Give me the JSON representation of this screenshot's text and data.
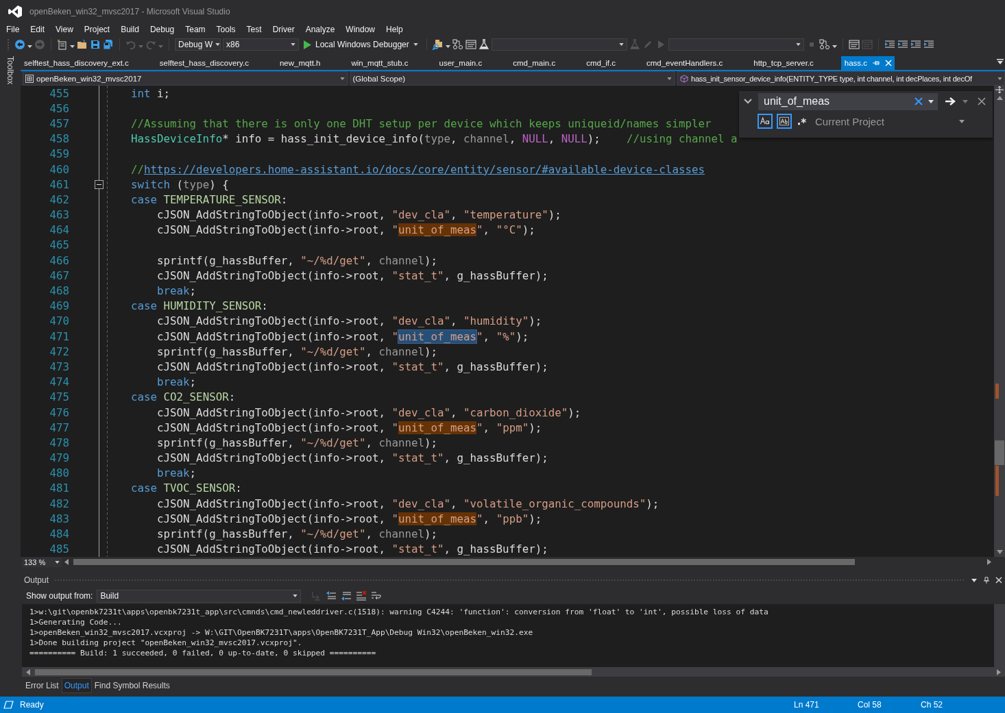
{
  "window": {
    "title": "openBeken_win32_mvsc2017 - Microsoft Visual Studio"
  },
  "menu": [
    "File",
    "Edit",
    "View",
    "Project",
    "Build",
    "Debug",
    "Team",
    "Tools",
    "Test",
    "Driver",
    "Analyze",
    "Window",
    "Help"
  ],
  "toolbar": [
    {
      "kind": "back",
      "disabled": false
    },
    {
      "kind": "caret",
      "disabled": false
    },
    {
      "kind": "forward",
      "disabled": true
    },
    {
      "kind": "sep"
    },
    {
      "kind": "new",
      "disabled": false
    },
    {
      "kind": "caret",
      "disabled": false
    },
    {
      "kind": "open",
      "disabled": false
    },
    {
      "kind": "save",
      "disabled": false
    },
    {
      "kind": "saveall",
      "disabled": false
    },
    {
      "kind": "sep"
    },
    {
      "kind": "undo",
      "disabled": true
    },
    {
      "kind": "caret",
      "disabled": true
    },
    {
      "kind": "redo",
      "disabled": true
    },
    {
      "kind": "caret",
      "disabled": true
    },
    {
      "kind": "sep"
    },
    {
      "kind": "combo",
      "value": "Debug W"
    },
    {
      "kind": "combo",
      "value": "x86"
    },
    {
      "kind": "run",
      "label": "Local Windows Debugger"
    },
    {
      "kind": "sep"
    },
    {
      "kind": "find",
      "disabled": false
    },
    {
      "kind": "caret",
      "disabled": false
    },
    {
      "kind": "branch",
      "disabled": false
    },
    {
      "kind": "window",
      "disabled": false
    },
    {
      "kind": "flask",
      "disabled": false
    },
    {
      "kind": "combo"
    },
    {
      "kind": "flask",
      "disabled": true
    },
    {
      "kind": "pencil",
      "disabled": true
    },
    {
      "kind": "play",
      "disabled": true
    },
    {
      "kind": "combo"
    },
    {
      "kind": "stop",
      "disabled": true
    },
    {
      "kind": "branch",
      "disabled": false
    },
    {
      "kind": "caret",
      "disabled": false
    },
    {
      "kind": "sep"
    },
    {
      "kind": "window",
      "disabled": false
    },
    {
      "kind": "window",
      "disabled": true
    },
    {
      "kind": "sep"
    },
    {
      "kind": "indent",
      "disabled": false
    },
    {
      "kind": "indent",
      "disabled": false
    },
    {
      "kind": "indent",
      "disabled": false
    },
    {
      "kind": "indent",
      "disabled": false
    }
  ],
  "toolbox": {
    "label": "Toolbox"
  },
  "tabs": [
    {
      "label": "selftest_hass_discovery_ext.c",
      "selected": false
    },
    {
      "label": "selftest_hass_discovery.c",
      "selected": false
    },
    {
      "label": "new_mqtt.h",
      "selected": false
    },
    {
      "label": "win_mqtt_stub.c",
      "selected": false
    },
    {
      "label": "user_main.c",
      "selected": false
    },
    {
      "label": "cmd_main.c",
      "selected": false
    },
    {
      "label": "cmd_if.c",
      "selected": false
    },
    {
      "label": "cmd_eventHandlers.c",
      "selected": false
    },
    {
      "label": "http_tcp_server.c",
      "selected": false
    },
    {
      "label": "hass.c",
      "selected": true
    }
  ],
  "nav_bar": {
    "project": "openBeken_win32_mvsc2017",
    "scope": "(Global Scope)",
    "member": "hass_init_sensor_device_info(ENTITY_TYPE type, int channel, int decPlaces, int decOf"
  },
  "editor": {
    "lines": [
      {
        "number": "455",
        "tokens": [
          {
            "kind": "keyword",
            "text": "int"
          },
          {
            "kind": "plain",
            "text": " i;"
          }
        ]
      },
      {
        "number": "456"
      },
      {
        "number": "457",
        "tokens": [
          {
            "kind": "comment",
            "text": "//Assuming that there is only one DHT setup per device which keeps uniqueid/names simpler"
          }
        ]
      },
      {
        "number": "458",
        "tokens": [
          {
            "kind": "type",
            "text": "HassDeviceInfo"
          },
          {
            "kind": "plain",
            "text": "* info = hass_init_device_info("
          },
          {
            "kind": "param",
            "text": "type"
          },
          {
            "kind": "plain",
            "text": ", "
          },
          {
            "kind": "param",
            "text": "channel"
          },
          {
            "kind": "plain",
            "text": ", "
          },
          {
            "kind": "macro",
            "text": "NULL"
          },
          {
            "kind": "plain",
            "text": ", "
          },
          {
            "kind": "macro",
            "text": "NULL"
          },
          {
            "kind": "plain",
            "text": ");    "
          },
          {
            "kind": "comment",
            "text": "//using channel a"
          }
        ]
      },
      {
        "number": "459"
      },
      {
        "number": "460",
        "tokens": [
          {
            "kind": "comment",
            "text": "//"
          },
          {
            "kind": "link",
            "text": "https://developers.home-assistant.io/docs/core/entity/sensor/#available-device-classes"
          }
        ]
      },
      {
        "number": "461",
        "collapsible": true,
        "tokens": [
          {
            "kind": "keyword",
            "text": "switch"
          },
          {
            "kind": "plain",
            "text": " ("
          },
          {
            "kind": "param",
            "text": "type"
          },
          {
            "kind": "plain",
            "text": ") {"
          }
        ]
      },
      {
        "number": "462",
        "tokens": [
          {
            "kind": "keyword",
            "text": "case "
          },
          {
            "kind": "enum",
            "text": "TEMPERATURE_SENSOR"
          },
          {
            "kind": "plain",
            "text": ":"
          }
        ]
      },
      {
        "number": "463",
        "tokens": [
          {
            "kind": "plain",
            "text": "    cJSON_AddStringToObject(info->root, "
          },
          {
            "kind": "string",
            "text": "\"dev_cla\""
          },
          {
            "kind": "plain",
            "text": ", "
          },
          {
            "kind": "string",
            "text": "\"temperature\""
          },
          {
            "kind": "plain",
            "text": ");"
          }
        ]
      },
      {
        "number": "464",
        "tokens": [
          {
            "kind": "plain",
            "text": "    cJSON_AddStringToObject(info->root, "
          },
          {
            "kind": "string",
            "text": "\""
          },
          {
            "kind": "string",
            "text": "unit_of_meas",
            "match": true,
            "current": false
          },
          {
            "kind": "string",
            "text": "\""
          },
          {
            "kind": "plain",
            "text": ", "
          },
          {
            "kind": "string",
            "text": "\"°C\""
          },
          {
            "kind": "plain",
            "text": ");"
          }
        ]
      },
      {
        "number": "465"
      },
      {
        "number": "466",
        "tokens": [
          {
            "kind": "plain",
            "text": "    sprintf(g_hassBuffer, "
          },
          {
            "kind": "string",
            "text": "\"~/%d/get\""
          },
          {
            "kind": "plain",
            "text": ", "
          },
          {
            "kind": "param",
            "text": "channel"
          },
          {
            "kind": "plain",
            "text": ");"
          }
        ]
      },
      {
        "number": "467",
        "tokens": [
          {
            "kind": "plain",
            "text": "    cJSON_AddStringToObject(info->root, "
          },
          {
            "kind": "string",
            "text": "\"stat_t\""
          },
          {
            "kind": "plain",
            "text": ", g_hassBuffer);"
          }
        ]
      },
      {
        "number": "468",
        "tokens": [
          {
            "kind": "keyword",
            "text": "    break"
          },
          {
            "kind": "plain",
            "text": ";"
          }
        ]
      },
      {
        "number": "469",
        "tokens": [
          {
            "kind": "keyword",
            "text": "case "
          },
          {
            "kind": "enum",
            "text": "HUMIDITY_SENSOR"
          },
          {
            "kind": "plain",
            "text": ":"
          }
        ]
      },
      {
        "number": "470",
        "tokens": [
          {
            "kind": "plain",
            "text": "    cJSON_AddStringToObject(info->root, "
          },
          {
            "kind": "string",
            "text": "\"dev_cla\""
          },
          {
            "kind": "plain",
            "text": ", "
          },
          {
            "kind": "string",
            "text": "\"humidity\""
          },
          {
            "kind": "plain",
            "text": ");"
          }
        ]
      },
      {
        "number": "471",
        "tokens": [
          {
            "kind": "plain",
            "text": "    cJSON_AddStringToObject(info->root, "
          },
          {
            "kind": "string",
            "text": "\""
          },
          {
            "kind": "string",
            "text": "unit_of_meas",
            "match": true,
            "current": true
          },
          {
            "kind": "string",
            "text": "\""
          },
          {
            "kind": "plain",
            "text": ", "
          },
          {
            "kind": "string",
            "text": "\"%\""
          },
          {
            "kind": "plain",
            "text": ");"
          }
        ]
      },
      {
        "number": "472",
        "tokens": [
          {
            "kind": "plain",
            "text": "    sprintf(g_hassBuffer, "
          },
          {
            "kind": "string",
            "text": "\"~/%d/get\""
          },
          {
            "kind": "plain",
            "text": ", "
          },
          {
            "kind": "param",
            "text": "channel"
          },
          {
            "kind": "plain",
            "text": ");"
          }
        ]
      },
      {
        "number": "473",
        "tokens": [
          {
            "kind": "plain",
            "text": "    cJSON_AddStringToObject(info->root, "
          },
          {
            "kind": "string",
            "text": "\"stat_t\""
          },
          {
            "kind": "plain",
            "text": ", g_hassBuffer);"
          }
        ]
      },
      {
        "number": "474",
        "tokens": [
          {
            "kind": "keyword",
            "text": "    break"
          },
          {
            "kind": "plain",
            "text": ";"
          }
        ]
      },
      {
        "number": "475",
        "tokens": [
          {
            "kind": "keyword",
            "text": "case "
          },
          {
            "kind": "enum",
            "text": "CO2_SENSOR"
          },
          {
            "kind": "plain",
            "text": ":"
          }
        ]
      },
      {
        "number": "476",
        "tokens": [
          {
            "kind": "plain",
            "text": "    cJSON_AddStringToObject(info->root, "
          },
          {
            "kind": "string",
            "text": "\"dev_cla\""
          },
          {
            "kind": "plain",
            "text": ", "
          },
          {
            "kind": "string",
            "text": "\"carbon_dioxide\""
          },
          {
            "kind": "plain",
            "text": ");"
          }
        ]
      },
      {
        "number": "477",
        "tokens": [
          {
            "kind": "plain",
            "text": "    cJSON_AddStringToObject(info->root, "
          },
          {
            "kind": "string",
            "text": "\""
          },
          {
            "kind": "string",
            "text": "unit_of_meas",
            "match": true,
            "current": false
          },
          {
            "kind": "string",
            "text": "\""
          },
          {
            "kind": "plain",
            "text": ", "
          },
          {
            "kind": "string",
            "text": "\"ppm\""
          },
          {
            "kind": "plain",
            "text": ");"
          }
        ]
      },
      {
        "number": "478",
        "tokens": [
          {
            "kind": "plain",
            "text": "    sprintf(g_hassBuffer, "
          },
          {
            "kind": "string",
            "text": "\"~/%d/get\""
          },
          {
            "kind": "plain",
            "text": ", "
          },
          {
            "kind": "param",
            "text": "channel"
          },
          {
            "kind": "plain",
            "text": ");"
          }
        ]
      },
      {
        "number": "479",
        "tokens": [
          {
            "kind": "plain",
            "text": "    cJSON_AddStringToObject(info->root, "
          },
          {
            "kind": "string",
            "text": "\"stat_t\""
          },
          {
            "kind": "plain",
            "text": ", g_hassBuffer);"
          }
        ]
      },
      {
        "number": "480",
        "tokens": [
          {
            "kind": "keyword",
            "text": "    break"
          },
          {
            "kind": "plain",
            "text": ";"
          }
        ]
      },
      {
        "number": "481",
        "tokens": [
          {
            "kind": "keyword",
            "text": "case "
          },
          {
            "kind": "enum",
            "text": "TVOC_SENSOR"
          },
          {
            "kind": "plain",
            "text": ":"
          }
        ]
      },
      {
        "number": "482",
        "tokens": [
          {
            "kind": "plain",
            "text": "    cJSON_AddStringToObject(info->root, "
          },
          {
            "kind": "string",
            "text": "\"dev_cla\""
          },
          {
            "kind": "plain",
            "text": ", "
          },
          {
            "kind": "string",
            "text": "\"volatile_organic_compounds\""
          },
          {
            "kind": "plain",
            "text": ");"
          }
        ]
      },
      {
        "number": "483",
        "tokens": [
          {
            "kind": "plain",
            "text": "    cJSON_AddStringToObject(info->root, "
          },
          {
            "kind": "string",
            "text": "\""
          },
          {
            "kind": "string",
            "text": "unit_of_meas",
            "match": true,
            "current": false
          },
          {
            "kind": "string",
            "text": "\""
          },
          {
            "kind": "plain",
            "text": ", "
          },
          {
            "kind": "string",
            "text": "\"ppb\""
          },
          {
            "kind": "plain",
            "text": ");"
          }
        ]
      },
      {
        "number": "484",
        "tokens": [
          {
            "kind": "plain",
            "text": "    sprintf(g_hassBuffer, "
          },
          {
            "kind": "string",
            "text": "\"~/%d/get\""
          },
          {
            "kind": "plain",
            "text": ", "
          },
          {
            "kind": "param",
            "text": "channel"
          },
          {
            "kind": "plain",
            "text": ");"
          }
        ]
      },
      {
        "number": "485",
        "tokens": [
          {
            "kind": "plain",
            "text": "    cJSON_AddStringToObject(info->root, "
          },
          {
            "kind": "string",
            "text": "\"stat_t\""
          },
          {
            "kind": "plain",
            "text": ", g_hassBuffer);"
          }
        ]
      }
    ],
    "zoom": "133 %"
  },
  "find": {
    "value": "unit_of_meas",
    "match_case": true,
    "whole_word": true,
    "regex": false,
    "scope": "Current Project"
  },
  "output": {
    "title": "Output",
    "show_from_label": "Show output from:",
    "source": "Build",
    "lines": [
      "1>w:\\git\\openbk7231t\\apps\\openbk7231t_app\\src\\cmnds\\cmd_newleddriver.c(1518): warning C4244: 'function': conversion from 'float' to 'int', possible loss of data",
      "1>Generating Code...",
      "1>openBeken_win32_mvsc2017.vcxproj -> W:\\GIT\\OpenBK7231T\\apps\\OpenBK7231T_App\\Debug Win32\\openBeken_win32.exe",
      "1>Done building project \"openBeken_win32_mvsc2017.vcxproj\".",
      "========== Build: 1 succeeded, 0 failed, 0 up-to-date, 0 skipped =========="
    ]
  },
  "bottom_tabs": [
    {
      "label": "Error List",
      "selected": false
    },
    {
      "label": "Output",
      "selected": true
    },
    {
      "label": "Find Symbol Results",
      "selected": false
    }
  ],
  "status_bar": {
    "state": "Ready",
    "line": "Ln 471",
    "column": "Col 58",
    "char": "Ch 52"
  }
}
